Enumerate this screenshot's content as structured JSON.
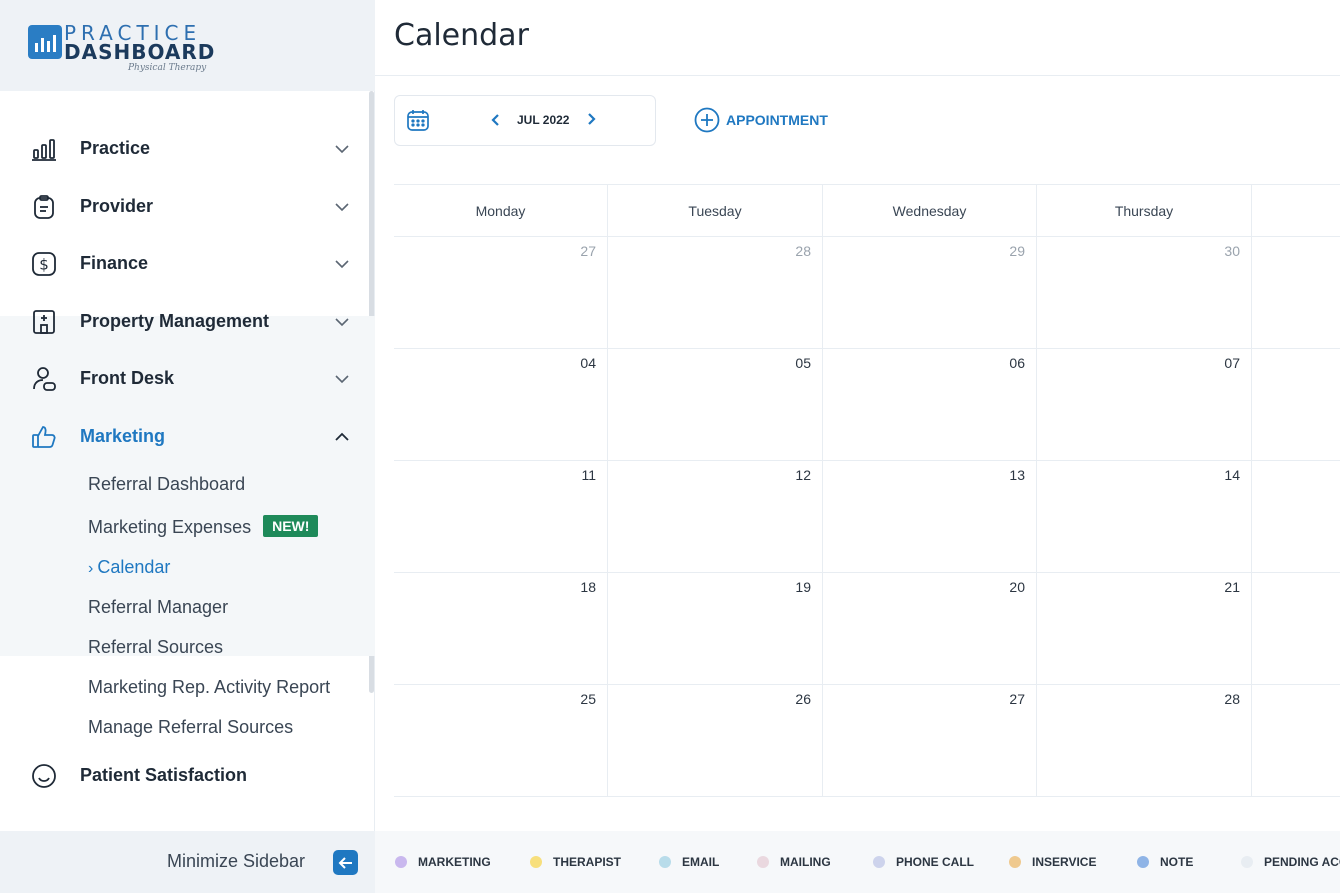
{
  "brand": {
    "line1": "PRACTICE",
    "line2": "DASHBOARD",
    "tagline": "Physical Therapy",
    "color": "#2a7dc4"
  },
  "sidebar": {
    "items": [
      {
        "label": "Practice",
        "icon": "bar-chart-icon"
      },
      {
        "label": "Provider",
        "icon": "clipboard-icon"
      },
      {
        "label": "Finance",
        "icon": "dollar-icon"
      },
      {
        "label": "Property Management",
        "icon": "building-icon"
      },
      {
        "label": "Front Desk",
        "icon": "person-desk-icon"
      },
      {
        "label": "Marketing",
        "icon": "thumbs-up-icon",
        "expanded": true
      },
      {
        "label": "Patient Satisfaction",
        "icon": "smile-icon"
      }
    ],
    "marketing_sub": [
      {
        "label": "Referral Dashboard"
      },
      {
        "label": "Marketing Expenses",
        "badge": "NEW!"
      },
      {
        "label": "Calendar",
        "current": true,
        "marker": "›"
      },
      {
        "label": "Referral Manager"
      },
      {
        "label": "Referral Sources"
      },
      {
        "label": "Marketing Rep. Activity Report"
      },
      {
        "label": "Manage Referral Sources"
      }
    ],
    "minimize_label": "Minimize Sidebar",
    "accent": "#1f78c1"
  },
  "header": {
    "title": "Calendar"
  },
  "toolbar": {
    "month_label": "JUL 2022",
    "appointment_label": "APPOINTMENT"
  },
  "calendar": {
    "days_of_week": [
      "Monday",
      "Tuesday",
      "Wednesday",
      "Thursday"
    ],
    "weeks": [
      [
        {
          "n": "27",
          "muted": true
        },
        {
          "n": "28",
          "muted": true
        },
        {
          "n": "29",
          "muted": true
        },
        {
          "n": "30",
          "muted": true
        }
      ],
      [
        {
          "n": "04"
        },
        {
          "n": "05"
        },
        {
          "n": "06"
        },
        {
          "n": "07"
        }
      ],
      [
        {
          "n": "11"
        },
        {
          "n": "12"
        },
        {
          "n": "13"
        },
        {
          "n": "14"
        }
      ],
      [
        {
          "n": "18"
        },
        {
          "n": "19"
        },
        {
          "n": "20"
        },
        {
          "n": "21"
        }
      ],
      [
        {
          "n": "25"
        },
        {
          "n": "26"
        },
        {
          "n": "27"
        },
        {
          "n": "28"
        }
      ]
    ]
  },
  "legend": [
    {
      "label": "MARKETING",
      "color": "#c9b8ee"
    },
    {
      "label": "THERAPIST",
      "color": "#f7df7c"
    },
    {
      "label": "EMAIL",
      "color": "#b8dcea"
    },
    {
      "label": "MAILING",
      "color": "#ead8df"
    },
    {
      "label": "PHONE CALL",
      "color": "#cdd3ec"
    },
    {
      "label": "INSERVICE",
      "color": "#efc98e"
    },
    {
      "label": "NOTE",
      "color": "#8fb4e6"
    },
    {
      "label": "PENDING ACC",
      "color": "#e8edf2"
    }
  ]
}
